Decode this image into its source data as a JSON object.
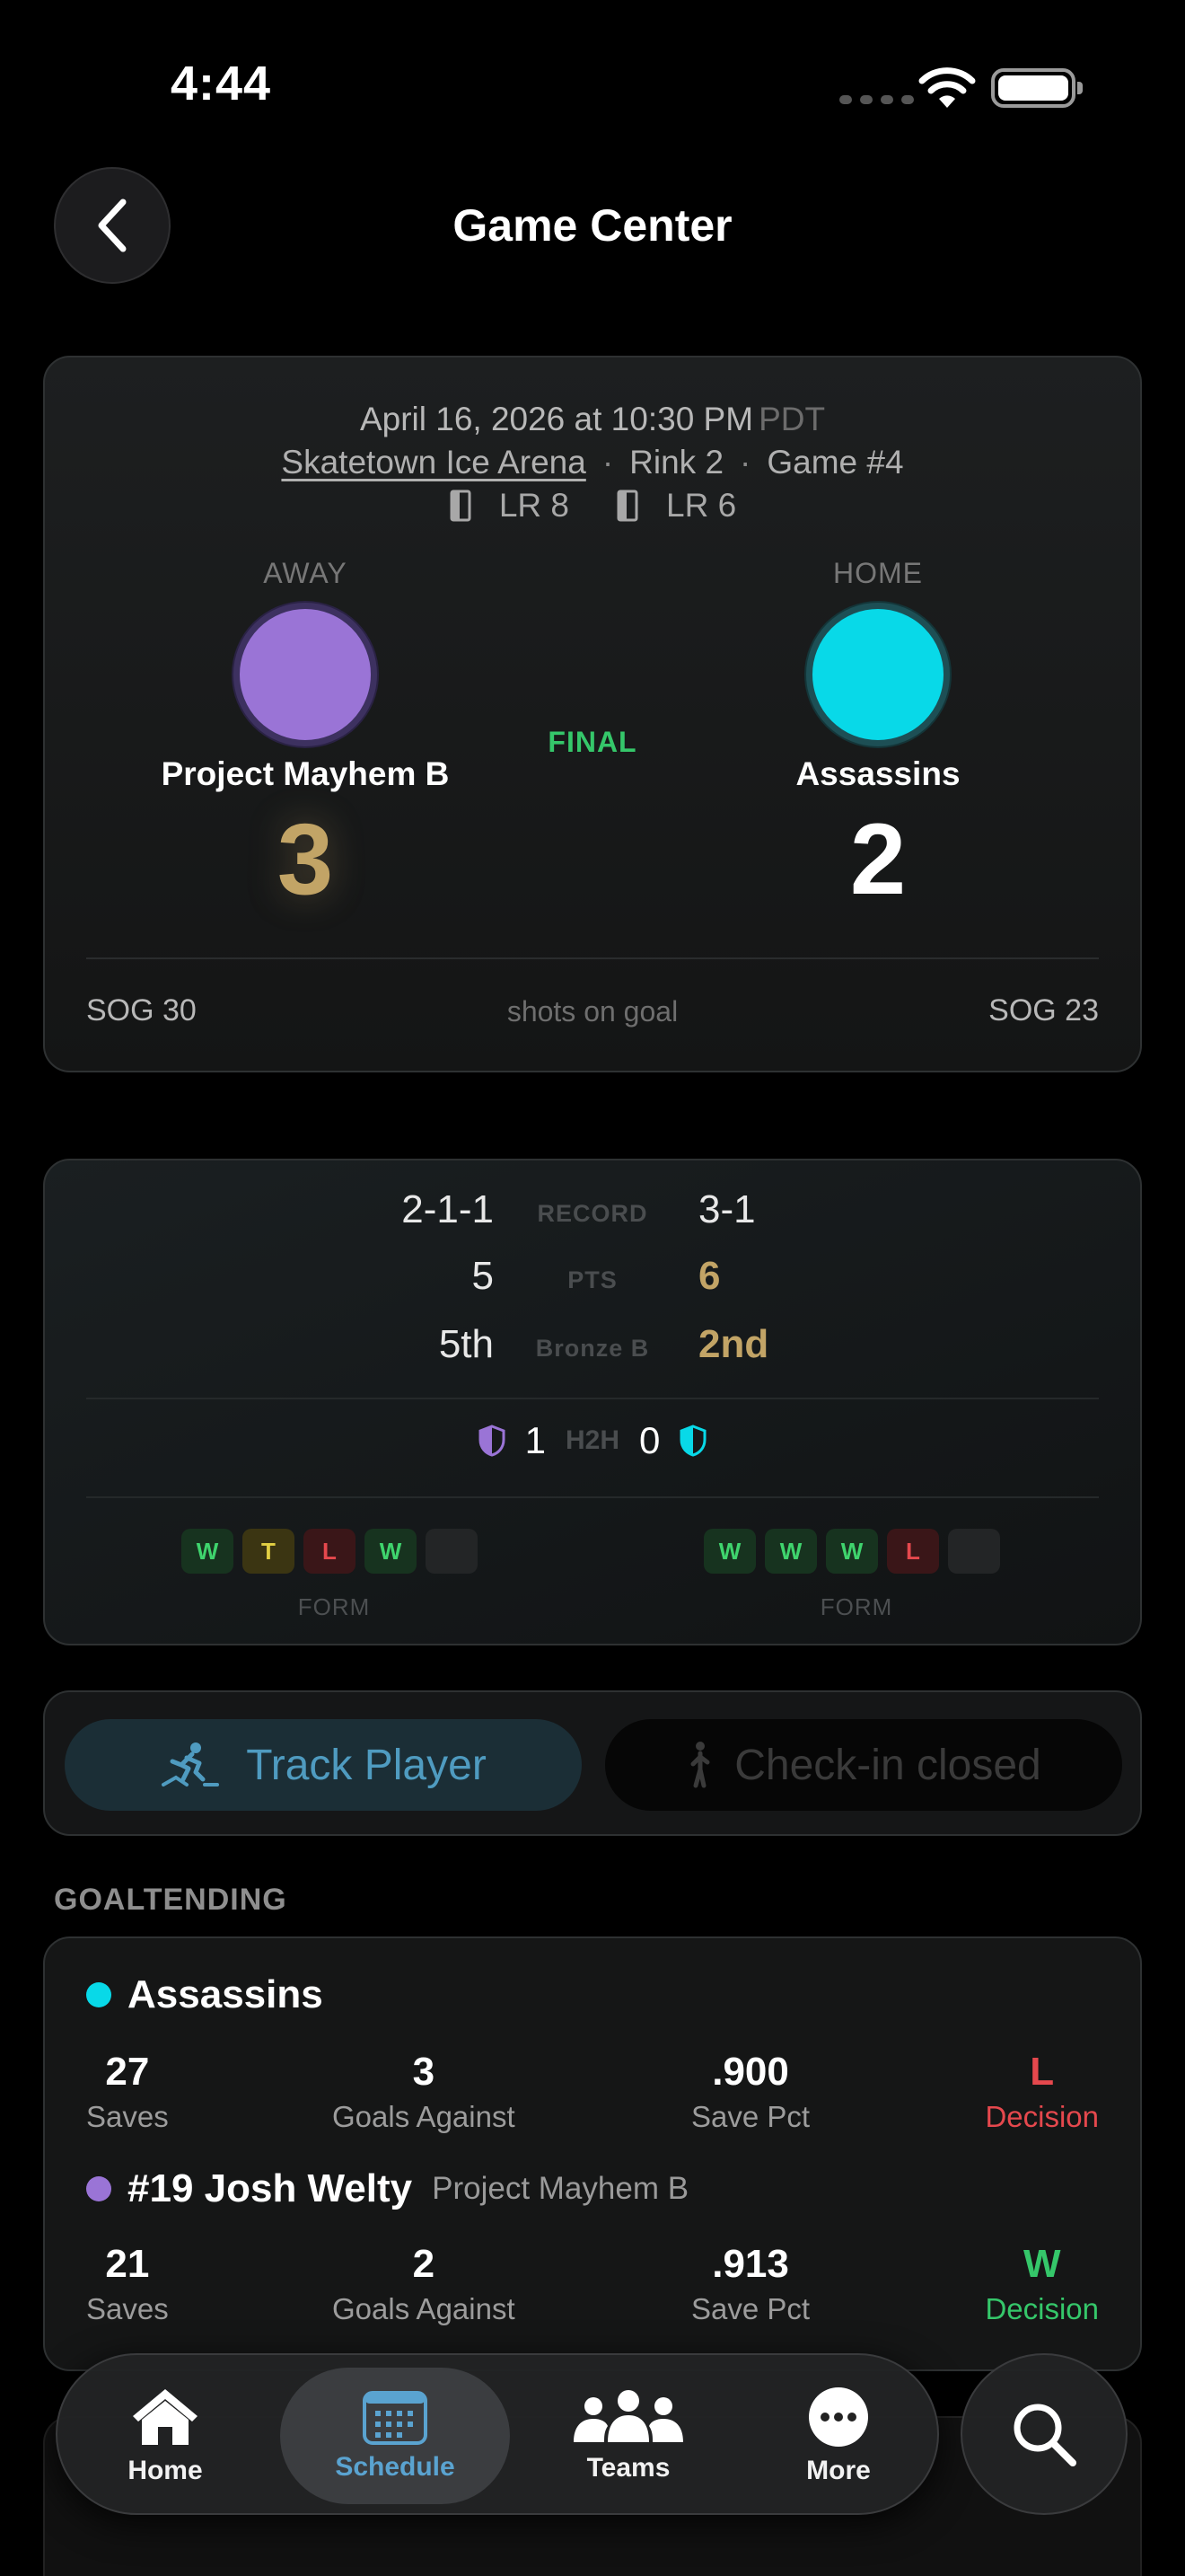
{
  "status_bar": {
    "time": "4:44"
  },
  "header": {
    "title": "Game Center"
  },
  "game": {
    "date": "April 16, 2026 at 10:30 PM",
    "timezone": "PDT",
    "venue": "Skatetown Ice Arena",
    "rink": "Rink 2",
    "game_number": "Game #4",
    "lockers": [
      "LR 8",
      "LR 6"
    ],
    "status": "FINAL",
    "away": {
      "side_label": "AWAY",
      "name": "Project Mayhem B",
      "score": "3",
      "sog": "SOG 30",
      "color": "#9a74d6"
    },
    "home": {
      "side_label": "HOME",
      "name": "Assassins",
      "score": "2",
      "sog": "SOG 23",
      "color": "#08d9e8"
    },
    "sog_label": "shots on goal"
  },
  "matchup": {
    "rows": [
      {
        "label": "RECORD",
        "away": "2-1-1",
        "home": "3-1"
      },
      {
        "label": "PTS",
        "away": "5",
        "home": "6"
      },
      {
        "label": "Bronze B",
        "away": "5th",
        "home": "2nd"
      }
    ],
    "h2h": {
      "label": "H2H",
      "away": "1",
      "home": "0"
    },
    "form_label": "FORM",
    "away_form": [
      "W",
      "T",
      "L",
      "W",
      ""
    ],
    "home_form": [
      "W",
      "W",
      "W",
      "L",
      ""
    ]
  },
  "actions": {
    "track": "Track Player",
    "checkin": "Check-in closed"
  },
  "goaltending": {
    "section_title": "GOALTENDING",
    "entries": [
      {
        "title": "Assassins",
        "subtitle": "",
        "color": "#08d9e8",
        "saves": "27",
        "saves_label": "Saves",
        "ga": "3",
        "ga_label": "Goals Against",
        "pct": ".900",
        "pct_label": "Save Pct",
        "decision": "L",
        "decision_label": "Decision"
      },
      {
        "title": "#19 Josh Welty",
        "subtitle": "Project Mayhem B",
        "color": "#9a74d6",
        "saves": "21",
        "saves_label": "Saves",
        "ga": "2",
        "ga_label": "Goals Against",
        "pct": ".913",
        "pct_label": "Save Pct",
        "decision": "W",
        "decision_label": "Decision"
      }
    ]
  },
  "tabs": [
    {
      "label": "Home",
      "icon": "house-icon"
    },
    {
      "label": "Schedule",
      "icon": "calendar-icon"
    },
    {
      "label": "Teams",
      "icon": "people-icon"
    },
    {
      "label": "More",
      "icon": "ellipsis-icon"
    }
  ],
  "search": {
    "icon": "search-icon"
  }
}
